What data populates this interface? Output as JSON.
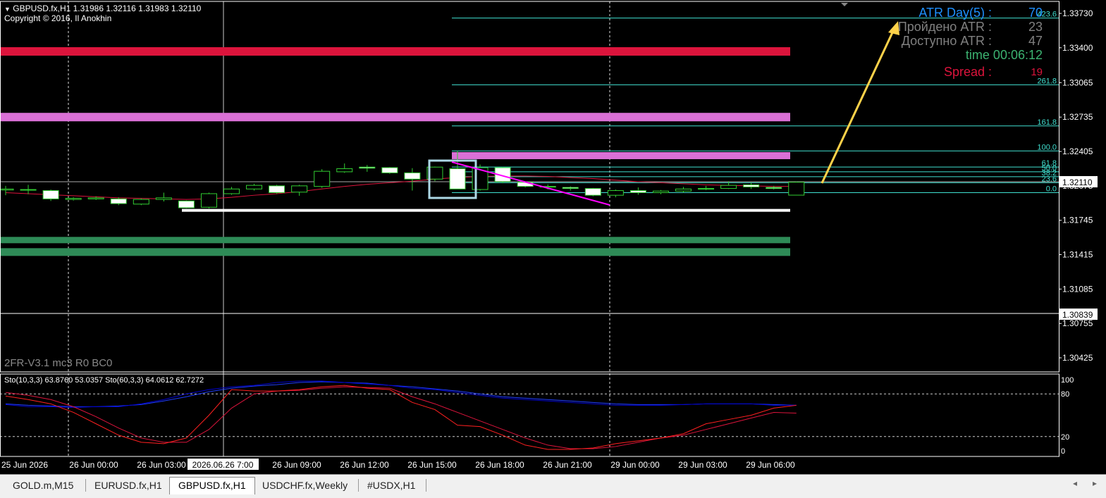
{
  "header": {
    "symbol_line": "GBPUSD.fx,H1  1.31986 1.32116 1.31983 1.32110",
    "copyright": "Copyright © 2016, Il Anokhin",
    "indicator_watermark": "2FR-V3.1 mc3 R0 BC0"
  },
  "atr_panel": {
    "atr_label": "ATR Day(5) :",
    "atr_value": "70",
    "passed_label": "Пройдено ATR :",
    "passed_value": "23",
    "available_label": "Доступно ATR :",
    "available_value": "47",
    "time_label": "time 00:06:12",
    "spread_label": "Spread :",
    "spread_value": "19",
    "colors": {
      "atr": "#1e90ff",
      "passed": "#808080",
      "time": "#3cb371",
      "spread": "#dc143c"
    }
  },
  "price_axis": {
    "labels": [
      "1.33730",
      "1.33400",
      "1.33065",
      "1.32735",
      "1.32405",
      "1.32075",
      "1.31745",
      "1.31415",
      "1.31085",
      "1.30755",
      "1.30425"
    ],
    "current_price": "1.32110",
    "marker_price": "1.30839"
  },
  "fibo_levels": [
    {
      "label": "423.6",
      "price": 1.33685
    },
    {
      "label": "261.8",
      "price": 1.33045
    },
    {
      "label": "161.8",
      "price": 1.3265
    },
    {
      "label": "100.0",
      "price": 1.3241
    },
    {
      "label": "61.8",
      "price": 1.32256
    },
    {
      "label": "50.0",
      "price": 1.3221
    },
    {
      "label": "38.2",
      "price": 1.32163
    },
    {
      "label": "23.6",
      "price": 1.32105
    },
    {
      "label": "0.0",
      "price": 1.3201
    }
  ],
  "zones": [
    {
      "name": "resistance-zone-red",
      "price": 1.33365,
      "color": "#dc143c"
    },
    {
      "name": "resistance-zone-violet",
      "price": 1.32735,
      "color": "#da70d6"
    },
    {
      "name": "zone-violet-mid",
      "price": 1.32365,
      "color": "#da70d6"
    },
    {
      "name": "support-line-white",
      "price": 1.3184,
      "color": "#ffffff"
    },
    {
      "name": "support-zone-green-1",
      "price": 1.31555,
      "color": "#2e8b57"
    },
    {
      "name": "support-zone-green-2",
      "price": 1.3144,
      "color": "#2e8b57"
    }
  ],
  "candles": [
    {
      "o": 1.32035,
      "h": 1.32075,
      "l": 1.31985,
      "c": 1.32045
    },
    {
      "o": 1.3204,
      "h": 1.32085,
      "l": 1.31995,
      "c": 1.32035
    },
    {
      "o": 1.3203,
      "h": 1.3204,
      "l": 1.3193,
      "c": 1.3195
    },
    {
      "o": 1.31945,
      "h": 1.31965,
      "l": 1.31935,
      "c": 1.31955
    },
    {
      "o": 1.3195,
      "h": 1.31975,
      "l": 1.3194,
      "c": 1.3196
    },
    {
      "o": 1.3195,
      "h": 1.31965,
      "l": 1.3189,
      "c": 1.31905
    },
    {
      "o": 1.319,
      "h": 1.31955,
      "l": 1.3189,
      "c": 1.31945
    },
    {
      "o": 1.31945,
      "h": 1.3201,
      "l": 1.31925,
      "c": 1.3196
    },
    {
      "o": 1.3193,
      "h": 1.31935,
      "l": 1.3186,
      "c": 1.31865
    },
    {
      "o": 1.3187,
      "h": 1.3201,
      "l": 1.3186,
      "c": 1.32
    },
    {
      "o": 1.32,
      "h": 1.32065,
      "l": 1.3199,
      "c": 1.32045
    },
    {
      "o": 1.32045,
      "h": 1.32095,
      "l": 1.3203,
      "c": 1.3208
    },
    {
      "o": 1.32075,
      "h": 1.32085,
      "l": 1.32,
      "c": 1.3201
    },
    {
      "o": 1.32015,
      "h": 1.32085,
      "l": 1.3198,
      "c": 1.32075
    },
    {
      "o": 1.3207,
      "h": 1.32235,
      "l": 1.32055,
      "c": 1.32215
    },
    {
      "o": 1.3221,
      "h": 1.3229,
      "l": 1.322,
      "c": 1.3224
    },
    {
      "o": 1.32255,
      "h": 1.32275,
      "l": 1.3221,
      "c": 1.32245
    },
    {
      "o": 1.3225,
      "h": 1.32255,
      "l": 1.3219,
      "c": 1.322
    },
    {
      "o": 1.322,
      "h": 1.32245,
      "l": 1.3203,
      "c": 1.3214
    },
    {
      "o": 1.3214,
      "h": 1.3226,
      "l": 1.3212,
      "c": 1.32255
    },
    {
      "o": 1.3224,
      "h": 1.3241,
      "l": 1.3205,
      "c": 1.32045
    },
    {
      "o": 1.3204,
      "h": 1.3228,
      "l": 1.3203,
      "c": 1.3225
    },
    {
      "o": 1.3225,
      "h": 1.32255,
      "l": 1.321,
      "c": 1.32115
    },
    {
      "o": 1.3211,
      "h": 1.32115,
      "l": 1.3206,
      "c": 1.3207
    },
    {
      "o": 1.3207,
      "h": 1.3209,
      "l": 1.3204,
      "c": 1.32065
    },
    {
      "o": 1.3206,
      "h": 1.3207,
      "l": 1.3203,
      "c": 1.3205
    },
    {
      "o": 1.3205,
      "h": 1.32055,
      "l": 1.31975,
      "c": 1.31985
    },
    {
      "o": 1.31985,
      "h": 1.3204,
      "l": 1.31965,
      "c": 1.3203
    },
    {
      "o": 1.3203,
      "h": 1.3206,
      "l": 1.3199,
      "c": 1.3201
    },
    {
      "o": 1.3201,
      "h": 1.32035,
      "l": 1.31995,
      "c": 1.32025
    },
    {
      "o": 1.32025,
      "h": 1.32065,
      "l": 1.3201,
      "c": 1.32045
    },
    {
      "o": 1.32045,
      "h": 1.32075,
      "l": 1.32035,
      "c": 1.3205
    },
    {
      "o": 1.3205,
      "h": 1.3212,
      "l": 1.32045,
      "c": 1.3208
    },
    {
      "o": 1.32085,
      "h": 1.32105,
      "l": 1.32045,
      "c": 1.32065
    },
    {
      "o": 1.3206,
      "h": 1.32075,
      "l": 1.3204,
      "c": 1.3205
    },
    {
      "o": 1.31986,
      "h": 1.32116,
      "l": 1.31983,
      "c": 1.3211
    }
  ],
  "moving_average": [
    1.3201,
    1.32,
    1.3199,
    1.3198,
    1.3197,
    1.3196,
    1.31955,
    1.3195,
    1.31945,
    1.3195,
    1.31965,
    1.31985,
    1.32,
    1.3202,
    1.32045,
    1.3207,
    1.3209,
    1.32105,
    1.3212,
    1.3214,
    1.32155,
    1.32165,
    1.3217,
    1.3217,
    1.32165,
    1.32155,
    1.32145,
    1.3213,
    1.32115,
    1.32105,
    1.32095,
    1.32085,
    1.3208,
    1.32075,
    1.3207,
    1.3207
  ],
  "stochastic": {
    "label": "Sto(10,3,3) 63.8760 53.0357  Sto(60,3,3) 64.0612 62.7272",
    "levels": [
      100,
      80,
      20,
      0
    ],
    "sto60_main": [
      65,
      62,
      62,
      61,
      62,
      62,
      66,
      72,
      80,
      86,
      90,
      92,
      96,
      98,
      98,
      96,
      94,
      92,
      88,
      86,
      82,
      78,
      74,
      72,
      70,
      68,
      66,
      64,
      64,
      64,
      65,
      66,
      66,
      66,
      64,
      64
    ],
    "sto60_signal": [
      66,
      64,
      63,
      62,
      62,
      63,
      65,
      70,
      76,
      83,
      88,
      91,
      93,
      96,
      97,
      96,
      95,
      92,
      90,
      87,
      84,
      80,
      76,
      74,
      72,
      70,
      68,
      66,
      65,
      65,
      65,
      66,
      66,
      66,
      65,
      64
    ],
    "sto10_main": [
      77,
      72,
      66,
      54,
      38,
      22,
      12,
      10,
      18,
      50,
      86,
      84,
      84,
      86,
      90,
      92,
      88,
      86,
      68,
      58,
      36,
      34,
      22,
      8,
      2,
      2,
      4,
      10,
      14,
      18,
      24,
      38,
      44,
      50,
      60,
      64
    ],
    "sto10_signal": [
      82,
      78,
      72,
      62,
      48,
      32,
      18,
      12,
      12,
      30,
      60,
      80,
      84,
      85,
      88,
      90,
      89,
      88,
      76,
      66,
      54,
      42,
      30,
      18,
      8,
      3,
      3,
      6,
      12,
      18,
      22,
      30,
      38,
      46,
      54,
      53
    ]
  },
  "time_axis": {
    "labels": [
      "25 Jun 2026",
      "26 Jun 00:00",
      "26 Jun 03:00",
      "26 Jun 09:00",
      "26 Jun 12:00",
      "26 Jun 15:00",
      "26 Jun 18:00",
      "26 Jun 21:00",
      "29 Jun 00:00",
      "29 Jun 03:00",
      "29 Jun 06:00"
    ],
    "crosshair_label": "2026.06.26 7:00"
  },
  "tabs": [
    {
      "label": "GOLD.m,M15",
      "active": false
    },
    {
      "label": "EURUSD.fx,H1",
      "active": false
    },
    {
      "label": "GBPUSD.fx,H1",
      "active": true
    },
    {
      "label": "USDCHF.fx,Weekly",
      "active": false
    },
    {
      "label": "#USDX,H1",
      "active": false
    }
  ],
  "nav": {
    "left": "◂",
    "right": "▸"
  }
}
